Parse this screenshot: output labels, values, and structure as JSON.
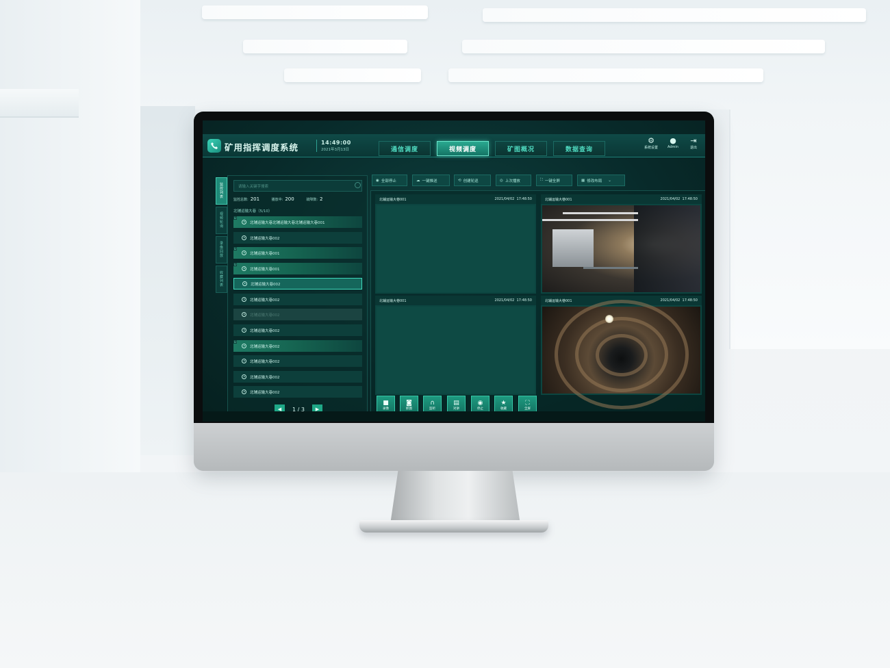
{
  "app": {
    "title": "矿用指挥调度系统",
    "time": "14:49:00",
    "date": "2021年3月13日"
  },
  "nav_tabs": [
    {
      "label": "通信调度",
      "active": false
    },
    {
      "label": "视频调度",
      "active": true
    },
    {
      "label": "矿图概况",
      "active": false
    },
    {
      "label": "数据查询",
      "active": false
    }
  ],
  "header_actions": [
    {
      "label": "系统设置",
      "icon": "gear-icon"
    },
    {
      "label": "Admin",
      "icon": "user-icon"
    },
    {
      "label": "退出",
      "icon": "logout-icon"
    }
  ],
  "side_tabs": [
    "监控列表",
    "视频轮询",
    "录像回放",
    "收藏列表"
  ],
  "search": {
    "placeholder": "请输入关键字搜索"
  },
  "stats": {
    "monitor_label": "监控总数:",
    "monitor_value": "201",
    "playing_label": "播放中:",
    "playing_value": "200",
    "fault_label": "故障数:",
    "fault_value": "2"
  },
  "group": {
    "label": "北辅运输大巷（5/10）"
  },
  "list_items": [
    {
      "label": "北辅运输大巷北辅运输大巷北辅运输大巷001",
      "state": "live"
    },
    {
      "label": "北辅运输大巷002",
      "state": "normal"
    },
    {
      "label": "北辅运输大巷001",
      "state": "live"
    },
    {
      "label": "北辅运输大巷001",
      "state": "live"
    },
    {
      "label": "北辅运输大巷002",
      "state": "selected"
    },
    {
      "label": "北辅运输大巷002",
      "state": "normal"
    },
    {
      "label": "北辅运输大巷002",
      "state": "disabled"
    },
    {
      "label": "北辅运输大巷002",
      "state": "normal"
    },
    {
      "label": "北辅运输大巷002",
      "state": "live"
    },
    {
      "label": "北辅运输大巷002",
      "state": "normal"
    },
    {
      "label": "北辅运输大巷002",
      "state": "normal"
    },
    {
      "label": "北辅运输大巷002",
      "state": "normal"
    }
  ],
  "pager": {
    "text": "1 / 3"
  },
  "toolbar": [
    {
      "label": "全部停止",
      "icon": "stop-circle-icon"
    },
    {
      "label": "一键推送",
      "icon": "cloud-icon"
    },
    {
      "label": "创建轮巡",
      "icon": "refresh-icon"
    },
    {
      "label": "上次播放",
      "icon": "play-circle-icon"
    },
    {
      "label": "一键全屏",
      "icon": "fullscreen-icon"
    },
    {
      "label": "修改布局",
      "icon": "grid-icon"
    }
  ],
  "video_cells": [
    {
      "name": "北辅运输大巷001",
      "date": "2021/04/02",
      "time": "17:48:50",
      "feed": "empty"
    },
    {
      "name": "北辅运输大巷001",
      "date": "2021/04/02",
      "time": "17:48:50",
      "feed": "camera-mine-equipment"
    },
    {
      "name": "北辅运输大巷001",
      "date": "2021/04/02",
      "time": "17:48:50",
      "feed": "empty"
    },
    {
      "name": "北辅运输大巷001",
      "date": "2021/04/02",
      "time": "17:48:50",
      "feed": "camera-mine-tunnel"
    }
  ],
  "controls": [
    {
      "label": "录像",
      "icon": "video-camera-icon"
    },
    {
      "label": "抓图",
      "icon": "camera-icon"
    },
    {
      "label": "监听",
      "icon": "headphones-icon"
    },
    {
      "label": "对讲",
      "icon": "intercom-icon"
    },
    {
      "label": "停止",
      "icon": "stop-icon"
    },
    {
      "label": "收藏",
      "icon": "star-icon"
    },
    {
      "label": "全屏",
      "icon": "fullscreen-icon"
    }
  ],
  "colors": {
    "accent": "#2aa88f",
    "background": "#082a2a",
    "text_accent": "#4fdac0"
  }
}
